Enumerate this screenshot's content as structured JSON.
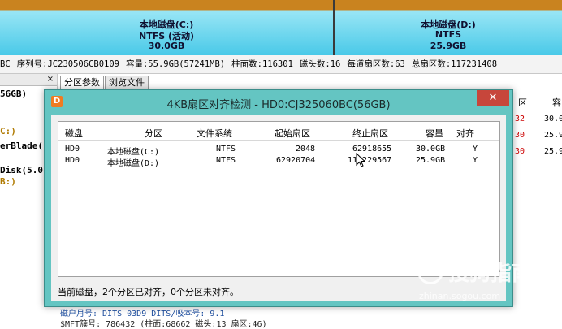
{
  "partitions": [
    {
      "name": "本地磁盘(C:)",
      "fs": "NTFS (活动)",
      "size": "30.0GB"
    },
    {
      "name": "本地磁盘(D:)",
      "fs": "NTFS",
      "size": "25.9GB"
    }
  ],
  "disk_info": {
    "prefix": "BC",
    "serial": "序列号:JC230506CB0109",
    "capacity": "容量:55.9GB(57241MB)",
    "cylinders": "柱面数:116301",
    "heads": "磁头数:16",
    "sectors_per_track": "每道扇区数:63",
    "total_sectors": "总扇区数:117231408"
  },
  "left_panel": {
    "close": "×",
    "items": [
      "56GB)",
      "C:)",
      "erBlade(",
      "Disk(5.0",
      "B:)"
    ]
  },
  "tabs": [
    {
      "label": "分区参数"
    },
    {
      "label": "浏览文件"
    }
  ],
  "right_columns": {
    "h1": "区",
    "h2": "容",
    "rows": [
      {
        "a": "32",
        "b": "30.0"
      },
      {
        "a": "30",
        "b": "25.9"
      },
      {
        "a": "30",
        "b": "25.9"
      }
    ]
  },
  "bottom_rows": {
    "row1": "磁户月号:              DITS 03D9    DITS/吸本号:                        9.1",
    "row2": "$MFT簇号:            786432 (柱面:68662 磁头:13 扇区:46)"
  },
  "dialog": {
    "title": "4KB扇区对齐检测 - HD0:CJ325060BC(56GB)",
    "close": "✕",
    "app_icon": "D",
    "columns": [
      "磁盘",
      "分区",
      "文件系统",
      "起始扇区",
      "终止扇区",
      "容量",
      "对齐"
    ],
    "rows": [
      {
        "disk": "HD0",
        "part": "本地磁盘(C:)",
        "fs": "NTFS",
        "start": "2048",
        "end": "62918655",
        "size": "30.0GB",
        "aligned": "Y"
      },
      {
        "disk": "HD0",
        "part": "本地磁盘(D:)",
        "fs": "NTFS",
        "start": "62920704",
        "end": "117229567",
        "size": "25.9GB",
        "aligned": "Y"
      }
    ],
    "status": "当前磁盘，2个分区已对齐，0个分区未对齐。"
  },
  "watermark": {
    "text": "搜狗指南",
    "sub": "zhinan.sogou.com"
  },
  "colors": {
    "partition_header": "#c9831f",
    "partition_fill": "#49c9e8",
    "dialog_frame": "#64c5c2",
    "close_button": "#c7463b"
  },
  "icons": [
    "app-icon",
    "close-icon",
    "mouse-cursor-icon"
  ]
}
